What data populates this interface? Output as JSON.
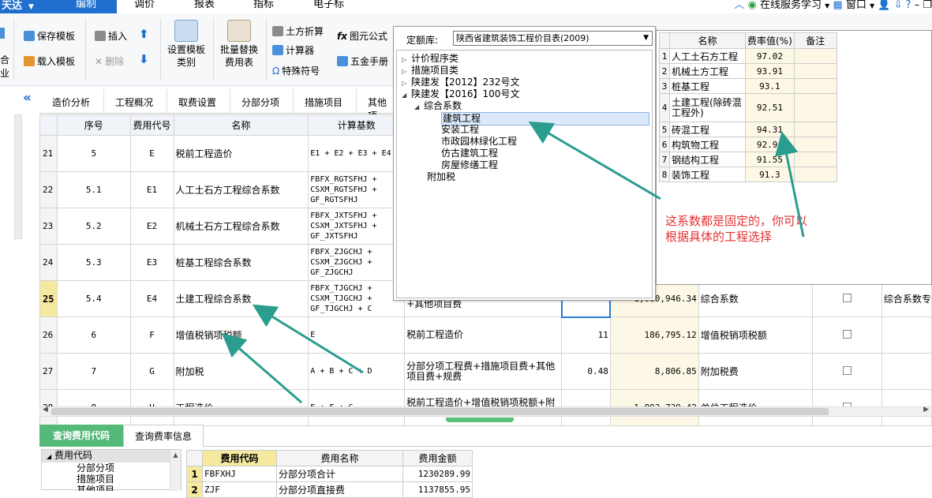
{
  "app": {
    "brand": "天达",
    "menu": [
      "编制",
      "调价",
      "报表",
      "指标",
      "电子标"
    ],
    "topright": {
      "online": "在线服务学习",
      "window": "窗口",
      "help": "?"
    }
  },
  "toolbar": {
    "left_labels": [
      "合",
      "业"
    ],
    "save_template": "保存模板",
    "load_template": "载入模板",
    "insert": "插入",
    "delete": "删除",
    "set_template_line1": "设置模板",
    "set_template_line2": "类别",
    "batch_replace_line1": "批量替换",
    "batch_replace_line2": "费用表",
    "earthwork": "土方折算",
    "calculator": "计算器",
    "special_symbols": "特殊符号",
    "formula": "图元公式",
    "hardware": "五金手册"
  },
  "page_tabs": [
    "造价分析",
    "工程概况",
    "取费设置",
    "分部分项",
    "措施项目",
    "其他项"
  ],
  "grid": {
    "headers": [
      "序号",
      "费用代号",
      "名称",
      "计算基数"
    ],
    "rows": [
      {
        "no": "21",
        "seq": "5",
        "code": "E",
        "name": "税前工程造价",
        "base": [
          "E1 + E2 + E3 + E4"
        ]
      },
      {
        "no": "22",
        "seq": "5.1",
        "code": "E1",
        "name": "人工土石方工程综合系数",
        "base": [
          "FBFX_RGTSFHJ +",
          "CSXM_RGTSFHJ +",
          "GF_RGTSFHJ"
        ]
      },
      {
        "no": "23",
        "seq": "5.2",
        "code": "E2",
        "name": "机械土石方工程综合系数",
        "base": [
          "FBFX_JXTSFHJ +",
          "CSXM_JXTSFHJ +",
          "GF_JXTSFHJ"
        ]
      },
      {
        "no": "24",
        "seq": "5.3",
        "code": "E3",
        "name": "桩基工程综合系数",
        "base": [
          "FBFX_ZJGCHJ +",
          "CSXM_ZJGCHJ +",
          "GF_ZJGCHJ"
        ]
      },
      {
        "no": "25",
        "seq": "5.4",
        "code": "E4",
        "name": "土建工程综合系数",
        "base": [
          "FBFX_TJGCHJ +",
          "CSXM_TJGCHJ +",
          "GF_TJGCHJ + C"
        ],
        "desc": "自土建工程合计+规费土建工程合计+其他项目费",
        "rate": "",
        "amount": "1,680,946.34",
        "type": "综合系数",
        "extra": "综合系数专"
      },
      {
        "no": "26",
        "seq": "6",
        "code": "F",
        "name": "增值税销项税额",
        "base": [
          "E"
        ],
        "desc": "税前工程造价",
        "rate": "11",
        "amount": "186,795.12",
        "type": "增值税销项税额"
      },
      {
        "no": "27",
        "seq": "7",
        "code": "G",
        "name": "附加税",
        "base": [
          "A + B + C + D"
        ],
        "desc": "分部分项工程费+措施项目费+其他项目费+规费",
        "rate": "0.48",
        "amount": "8,806.85",
        "type": "附加税费"
      },
      {
        "no": "28",
        "seq": "8",
        "code": "H",
        "name": "工程造价",
        "base": [
          "E + F + G"
        ],
        "desc": "税前工程造价+增值税销项税额+附加税",
        "rate": "",
        "amount": "1,893,739.42",
        "type": "单位工程造价"
      }
    ]
  },
  "popup": {
    "label": "定额库:",
    "selected": "陕西省建筑装饰工程价目表(2009)",
    "tree": [
      {
        "t": "计价程序类",
        "lvl": 0,
        "tw": "▷"
      },
      {
        "t": "措施项目类",
        "lvl": 0,
        "tw": "▷"
      },
      {
        "t": "陕建发【2012】232号文",
        "lvl": 0,
        "tw": "▷"
      },
      {
        "t": "陕建发【2016】100号文",
        "lvl": 0,
        "tw": "◢"
      },
      {
        "t": "综合系数",
        "lvl": 1,
        "tw": "◢"
      },
      {
        "t": "建筑工程",
        "lvl": 2,
        "tw": ""
      },
      {
        "t": "安装工程",
        "lvl": 2,
        "tw": ""
      },
      {
        "t": "市政园林绿化工程",
        "lvl": 2,
        "tw": ""
      },
      {
        "t": "仿古建筑工程",
        "lvl": 2,
        "tw": ""
      },
      {
        "t": "房屋修缮工程",
        "lvl": 2,
        "tw": ""
      },
      {
        "t": "附加税",
        "lvl": 1,
        "tw": ""
      }
    ]
  },
  "rates": {
    "headers": [
      "名称",
      "费率值(%)",
      "备注"
    ],
    "rows": [
      {
        "i": "1",
        "name": "人工土石方工程",
        "v": "97.02"
      },
      {
        "i": "2",
        "name": "机械土方工程",
        "v": "93.91"
      },
      {
        "i": "3",
        "name": "桩基工程",
        "v": "93.1"
      },
      {
        "i": "4",
        "name": "土建工程(除砖混工程外)",
        "v": "92.51"
      },
      {
        "i": "5",
        "name": "砖混工程",
        "v": "94.31"
      },
      {
        "i": "6",
        "name": "构筑物工程",
        "v": "92.94"
      },
      {
        "i": "7",
        "name": "钢结构工程",
        "v": "91.55"
      },
      {
        "i": "8",
        "name": "装饰工程",
        "v": "91.3"
      }
    ]
  },
  "annotation": {
    "line1": "这系数都是固定的，你可以",
    "line2": "根据具体的工程选择"
  },
  "bottom": {
    "tabs": [
      "查询费用代码",
      "查询费率信息"
    ],
    "tree": [
      "费用代码",
      "分部分项",
      "措施项目",
      "其他项目"
    ],
    "headers": [
      "费用代码",
      "费用名称",
      "费用金额"
    ],
    "rows": [
      {
        "i": "1",
        "code": "FBFXHJ",
        "name": "分部分项合计",
        "amt": "1230289.99"
      },
      {
        "i": "2",
        "code": "ZJF",
        "name": "分部分项直接费",
        "amt": "1137855.95"
      }
    ]
  },
  "colors": {
    "brand": "#1f6fcf",
    "accent_green": "#55b97a",
    "arrow": "#2a9d8f",
    "annotation": "#e53131"
  }
}
